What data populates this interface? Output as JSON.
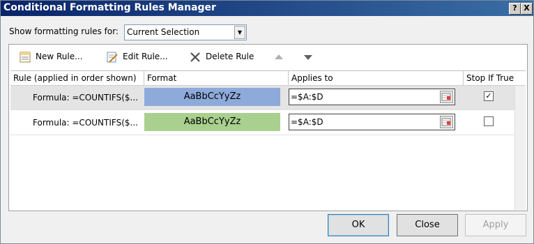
{
  "window": {
    "title": "Conditional Formatting Rules Manager",
    "help_glyph": "?",
    "close_glyph": "X"
  },
  "show_rules": {
    "label": "Show formatting rules for:",
    "selected": "Current Selection"
  },
  "toolbar": {
    "new_rule": "New Rule...",
    "edit_rule": "Edit Rule...",
    "delete_rule": "Delete Rule"
  },
  "columns": {
    "rule": "Rule (applied in order shown)",
    "format": "Format",
    "applies_to": "Applies to",
    "stop_if_true": "Stop If True"
  },
  "rules": [
    {
      "rule": "Formula: =COUNTIFS($...",
      "preview": "AaBbCcYyZz",
      "format_color": "#8eaadb",
      "applies_to": "=$A:$D",
      "stop_if_true": "✓",
      "selected": true
    },
    {
      "rule": "Formula: =COUNTIFS($...",
      "preview": "AaBbCcYyZz",
      "format_color": "#a9d08e",
      "applies_to": "=$A:$D",
      "stop_if_true": "",
      "selected": false
    }
  ],
  "buttons": {
    "ok": "OK",
    "close": "Close",
    "apply": "Apply"
  }
}
